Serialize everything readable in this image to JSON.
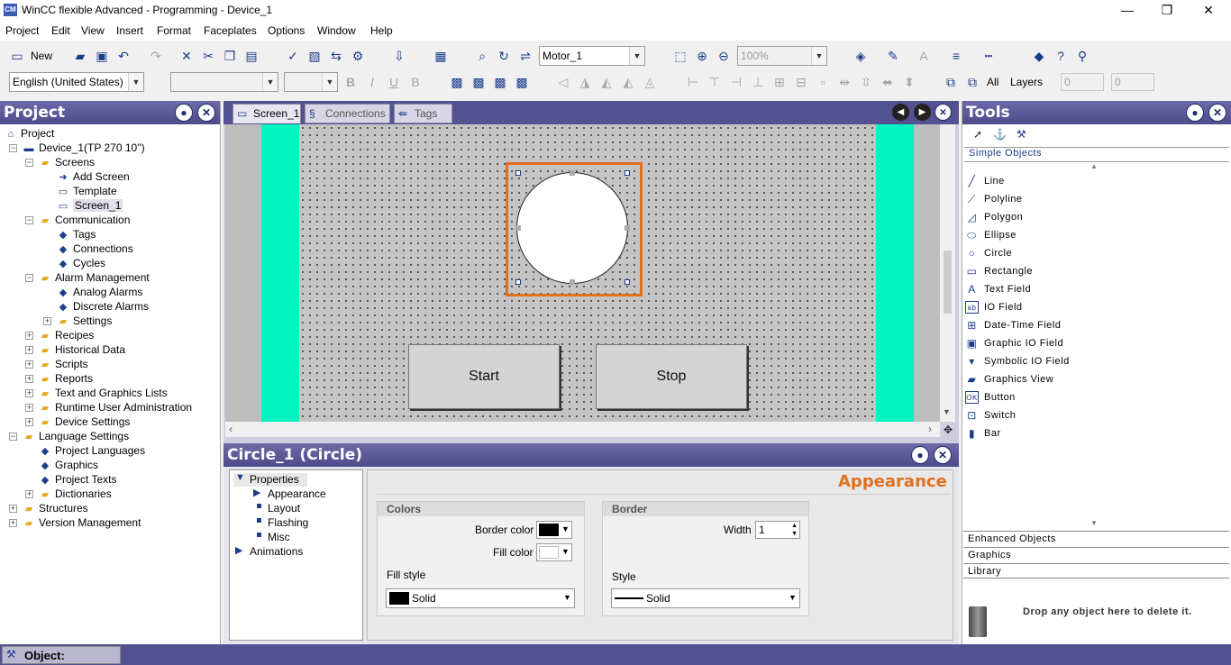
{
  "window": {
    "title": "WinCC flexible Advanced - Programming - Device_1",
    "app_icon": "CM",
    "minimize": "—",
    "restore": "❐",
    "close": "✕"
  },
  "menu": [
    "Project",
    "Edit",
    "View",
    "Insert",
    "Format",
    "Faceplates",
    "Options",
    "Window",
    "Help"
  ],
  "toolbar": {
    "new_label": "New",
    "tag_combo": "Motor_1",
    "zoom_combo": "100%",
    "language_combo": "English (United States)",
    "all_label": "All",
    "layers_label": "Layers",
    "layer_from": "0",
    "layer_to": "0"
  },
  "project_panel": {
    "title": "Project",
    "items": [
      {
        "label": "Project",
        "icon": "project-icon"
      },
      {
        "label": "Device_1(TP 270 10'')",
        "icon": "device-icon"
      },
      {
        "label": "Screens",
        "icon": "folder-icon"
      },
      {
        "label": "Add Screen",
        "icon": "add-screen-icon"
      },
      {
        "label": "Template",
        "icon": "template-icon"
      },
      {
        "label": "Screen_1",
        "icon": "screen-icon"
      },
      {
        "label": "Communication",
        "icon": "folder-icon"
      },
      {
        "label": "Tags",
        "icon": "tags-icon"
      },
      {
        "label": "Connections",
        "icon": "connections-icon"
      },
      {
        "label": "Cycles",
        "icon": "cycles-icon"
      },
      {
        "label": "Alarm Management",
        "icon": "folder-icon"
      },
      {
        "label": "Analog Alarms",
        "icon": "analog-alarm-icon"
      },
      {
        "label": "Discrete Alarms",
        "icon": "discrete-alarm-icon"
      },
      {
        "label": "Settings",
        "icon": "settings-icon"
      },
      {
        "label": "Recipes",
        "icon": "recipes-icon"
      },
      {
        "label": "Historical Data",
        "icon": "historical-data-icon"
      },
      {
        "label": "Scripts",
        "icon": "scripts-icon"
      },
      {
        "label": "Reports",
        "icon": "reports-icon"
      },
      {
        "label": "Text and Graphics Lists",
        "icon": "text-lists-icon"
      },
      {
        "label": "Runtime User Administration",
        "icon": "user-admin-icon"
      },
      {
        "label": "Device Settings",
        "icon": "device-settings-icon"
      },
      {
        "label": "Language Settings",
        "icon": "language-icon"
      },
      {
        "label": "Project Languages",
        "icon": "globe-icon"
      },
      {
        "label": "Graphics",
        "icon": "graphics-icon"
      },
      {
        "label": "Project Texts",
        "icon": "texts-icon"
      },
      {
        "label": "Dictionaries",
        "icon": "dictionary-icon"
      },
      {
        "label": "Structures",
        "icon": "structures-icon"
      },
      {
        "label": "Version Management",
        "icon": "version-icon"
      }
    ]
  },
  "editor": {
    "tabs": [
      "Screen_1",
      "Connections",
      "Tags"
    ],
    "buttons": {
      "start": "Start",
      "stop": "Stop"
    }
  },
  "properties": {
    "title": "Circle_1 (Circle)",
    "tree": [
      "Properties",
      "Appearance",
      "Layout",
      "Flashing",
      "Misc",
      "Animations"
    ],
    "section_title": "Appearance",
    "colors_group": "Colors",
    "border_color_label": "Border color",
    "fill_color_label": "Fill color",
    "fill_style_label": "Fill style",
    "fill_style_value": "Solid",
    "border_group": "Border",
    "width_label": "Width",
    "width_value": "1",
    "style_label": "Style",
    "style_value": "Solid"
  },
  "tools_panel": {
    "title": "Tools",
    "category": "Simple Objects",
    "items": [
      {
        "label": "Line",
        "icon": "line-icon"
      },
      {
        "label": "Polyline",
        "icon": "polyline-icon"
      },
      {
        "label": "Polygon",
        "icon": "polygon-icon"
      },
      {
        "label": "Ellipse",
        "icon": "ellipse-icon"
      },
      {
        "label": "Circle",
        "icon": "circle-icon"
      },
      {
        "label": "Rectangle",
        "icon": "rectangle-icon"
      },
      {
        "label": "Text Field",
        "icon": "text-field-icon"
      },
      {
        "label": "IO Field",
        "icon": "io-field-icon"
      },
      {
        "label": "Date-Time Field",
        "icon": "datetime-icon"
      },
      {
        "label": "Graphic IO Field",
        "icon": "graphic-io-icon"
      },
      {
        "label": "Symbolic IO Field",
        "icon": "symbolic-io-icon"
      },
      {
        "label": "Graphics View",
        "icon": "graphics-view-icon"
      },
      {
        "label": "Button",
        "icon": "button-icon"
      },
      {
        "label": "Switch",
        "icon": "switch-icon"
      },
      {
        "label": "Bar",
        "icon": "bar-icon"
      }
    ],
    "accordion": [
      "Enhanced Objects",
      "Graphics",
      "Library"
    ],
    "delete_hint": "Drop any object here to delete it."
  },
  "status": {
    "object_label": "Object:"
  },
  "colors": {
    "accent_orange": "#e07020",
    "green_strip": "#00f5c0",
    "panel_header": "#525290"
  }
}
